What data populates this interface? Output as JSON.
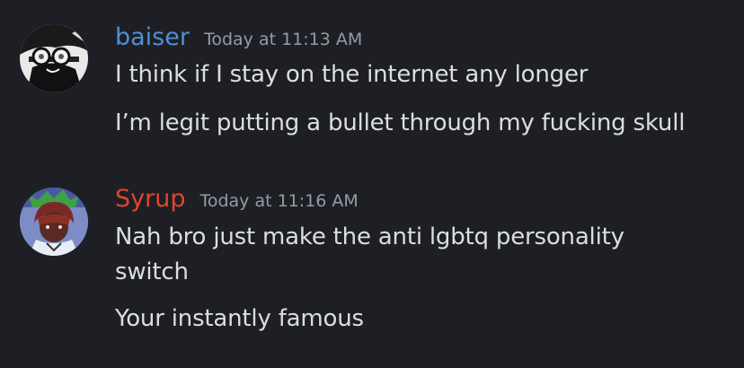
{
  "colors": {
    "background": "#1e1f24",
    "message_text": "#dbdee1",
    "timestamp": "#949ba4"
  },
  "messages": [
    {
      "username": "baiser",
      "username_color": "#4f8fd6",
      "timestamp": "Today at 11:13 AM",
      "avatar_icon": "bw-character-goggles-avatar",
      "lines": [
        "I think if I stay on the internet any longer",
        "I’m legit putting a bullet through my fucking skull"
      ]
    },
    {
      "username": "Syrup",
      "username_color": "#e0442f",
      "timestamp": "Today at 11:16 AM",
      "avatar_icon": "red-haired-character-avatar",
      "lines": [
        "Nah bro just make the anti lgbtq personality",
        "switch",
        "Your instantly famous"
      ]
    }
  ]
}
